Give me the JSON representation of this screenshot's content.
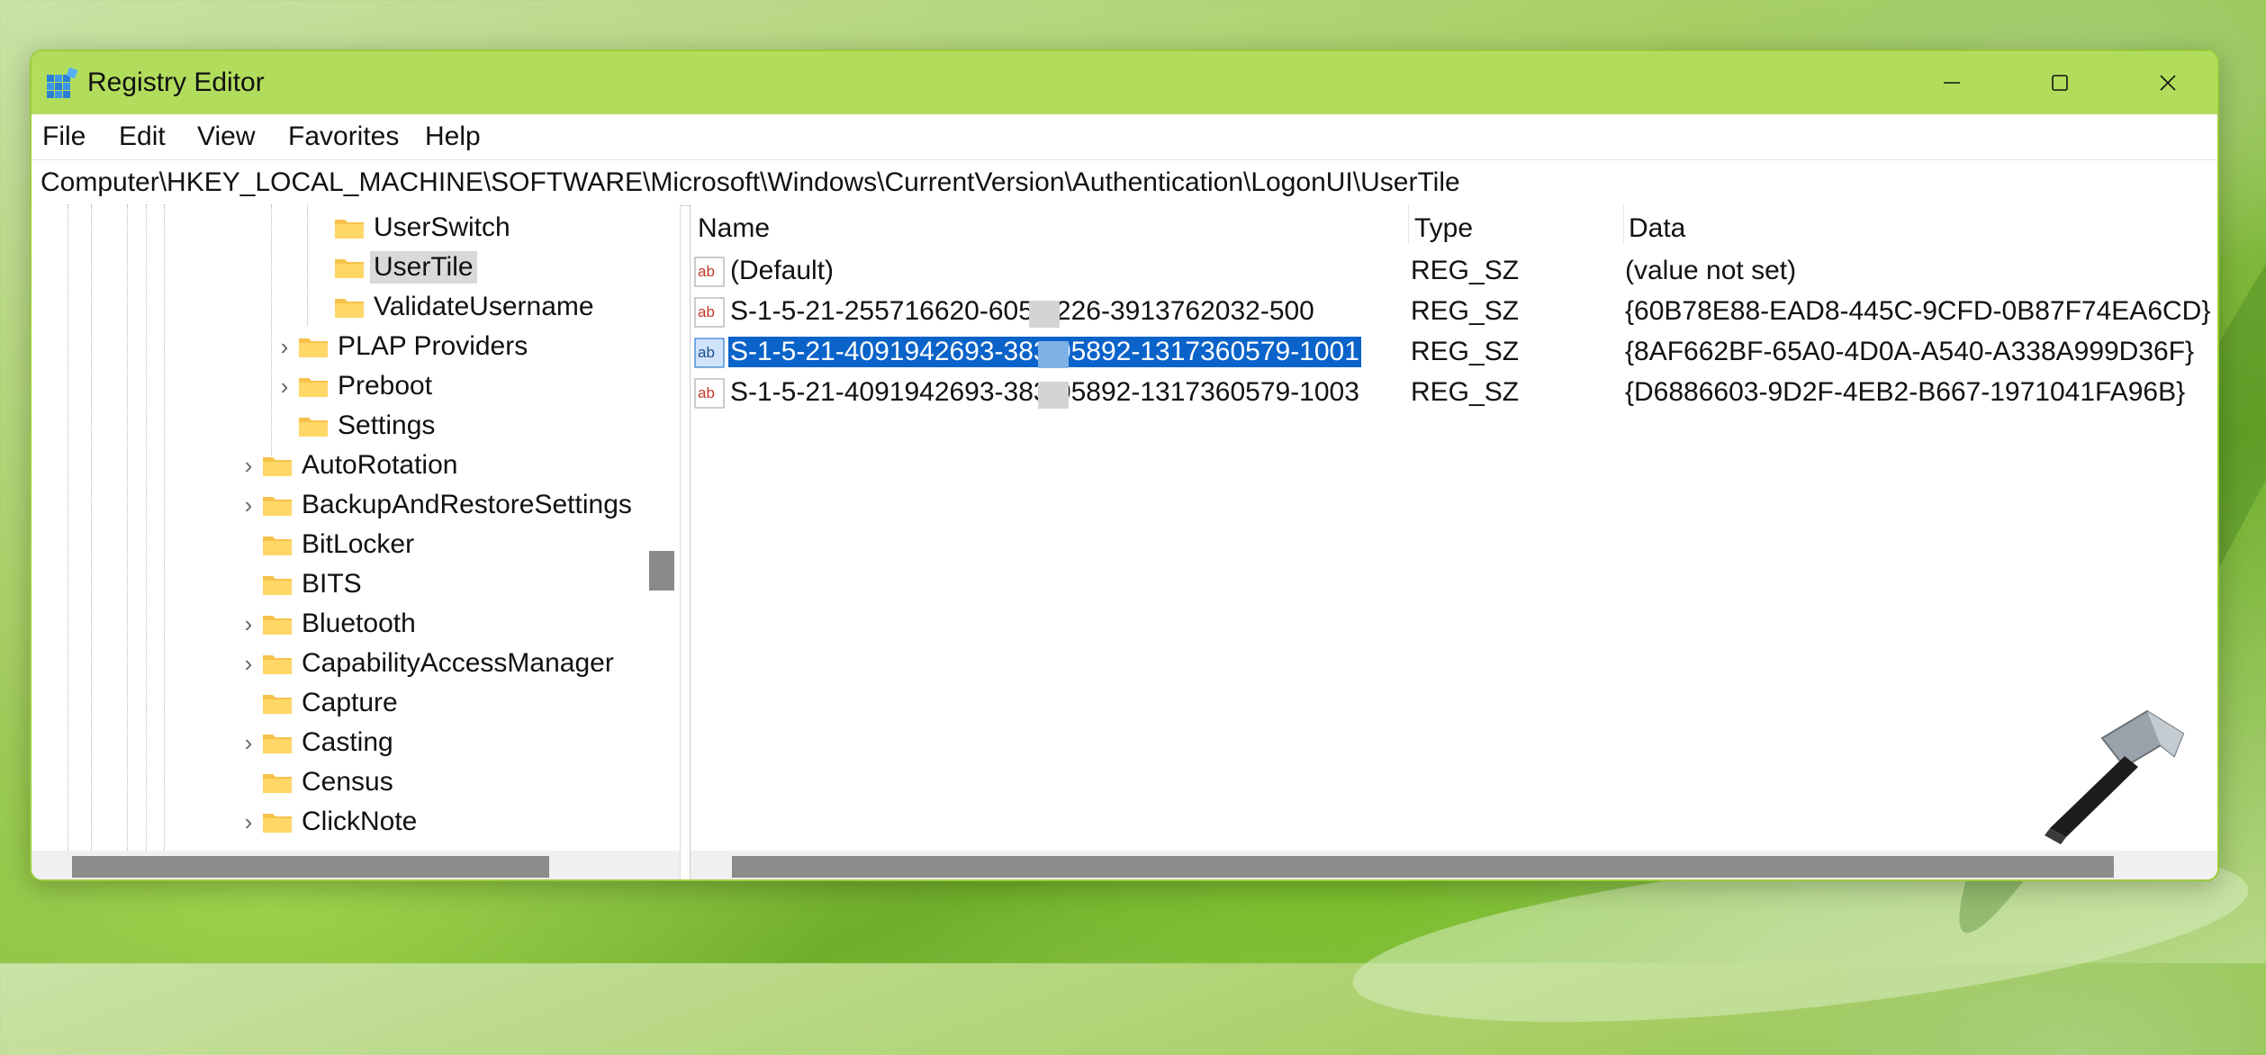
{
  "window": {
    "title": "Registry Editor",
    "accent_color": "#b2dd5c",
    "icons": {
      "app": "registry-editor-icon",
      "minimize": "minimize-icon",
      "maximize": "maximize-icon",
      "close": "close-icon"
    }
  },
  "menu": {
    "items": [
      {
        "label": "File"
      },
      {
        "label": "Edit"
      },
      {
        "label": "View"
      },
      {
        "label": "Favorites"
      },
      {
        "label": "Help"
      }
    ]
  },
  "address": {
    "path": "Computer\\HKEY_LOCAL_MACHINE\\SOFTWARE\\Microsoft\\Windows\\CurrentVersion\\Authentication\\LogonUI\\UserTile"
  },
  "tree": {
    "items": [
      {
        "label": "UserSwitch",
        "expandable": false,
        "selected": false
      },
      {
        "label": "UserTile",
        "expandable": false,
        "selected": true
      },
      {
        "label": "ValidateUsername",
        "expandable": false,
        "selected": false
      },
      {
        "label": "PLAP Providers",
        "expandable": true,
        "selected": false
      },
      {
        "label": "Preboot",
        "expandable": true,
        "selected": false
      },
      {
        "label": "Settings",
        "expandable": false,
        "selected": false
      },
      {
        "label": "AutoRotation",
        "expandable": true,
        "selected": false
      },
      {
        "label": "BackupAndRestoreSettings",
        "expandable": true,
        "selected": false
      },
      {
        "label": "BitLocker",
        "expandable": false,
        "selected": false
      },
      {
        "label": "BITS",
        "expandable": false,
        "selected": false
      },
      {
        "label": "Bluetooth",
        "expandable": true,
        "selected": false
      },
      {
        "label": "CapabilityAccessManager",
        "expandable": true,
        "selected": false
      },
      {
        "label": "Capture",
        "expandable": false,
        "selected": false
      },
      {
        "label": "Casting",
        "expandable": true,
        "selected": false
      },
      {
        "label": "Census",
        "expandable": false,
        "selected": false
      },
      {
        "label": "ClickNote",
        "expandable": true,
        "selected": false
      }
    ]
  },
  "values": {
    "columns": {
      "name": "Name",
      "type": "Type",
      "data": "Data"
    },
    "rows": [
      {
        "name": "(Default)",
        "type": "REG_SZ",
        "data": "(value not set)",
        "selected": false
      },
      {
        "name": "S-1-5-21-255716620-605    7226-3913762032-500",
        "type": "REG_SZ",
        "data": "{60B78E88-EAD8-445C-9CFD-0B87F74EA6CD}",
        "selected": false
      },
      {
        "name": "S-1-5-21-4091942693-383    05892-1317360579-1001",
        "type": "REG_SZ",
        "data": "{8AF662BF-65A0-4D0A-A540-A338A999D36F}",
        "selected": true
      },
      {
        "name": "S-1-5-21-4091942693-383    05892-1317360579-1003",
        "type": "REG_SZ",
        "data": "{D6886603-9D2F-4EB2-B667-1971041FA96B}",
        "selected": false
      }
    ],
    "icon": "string-value-ab-icon",
    "selection_color": "#0a63c9"
  },
  "overlay": {
    "logo": "hammer-logo"
  }
}
